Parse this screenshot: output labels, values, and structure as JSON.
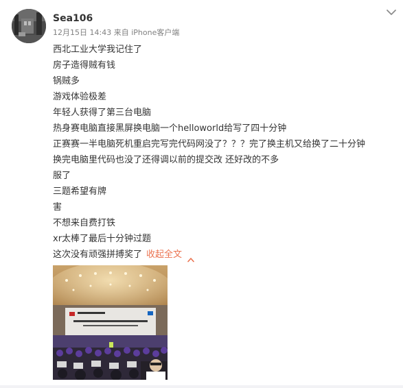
{
  "post": {
    "username": "Sea106",
    "timestamp": "12月15日 14:43",
    "source_prefix": "来自",
    "source": "iPhone客户端",
    "lines": [
      "西北工业大学我记住了",
      "房子造得贼有钱",
      "锅贼多",
      "游戏体验极差",
      "年轻人获得了第三台电脑",
      "热身赛电脑直接黑屏换电脑一个helloworld给写了四十分钟",
      "正赛赛一半电脑死机重启完写完代码网没了？？？完了换主机又给换了二十分钟",
      "换完电脑里代码也没了还得调以前的提交改 还好改的不多",
      "服了",
      "三题希望有牌",
      "害",
      "不想来自费打铁",
      "xr太棒了最后十分钟过题",
      "这次没有顽强拼搏奖了"
    ],
    "collapse_label": "收起全文",
    "icons": {
      "menu": "chevron-down-icon",
      "collapse": "chevron-up-icon"
    },
    "colors": {
      "link": "#eb7350",
      "meta": "#808080",
      "text": "#333333"
    }
  }
}
